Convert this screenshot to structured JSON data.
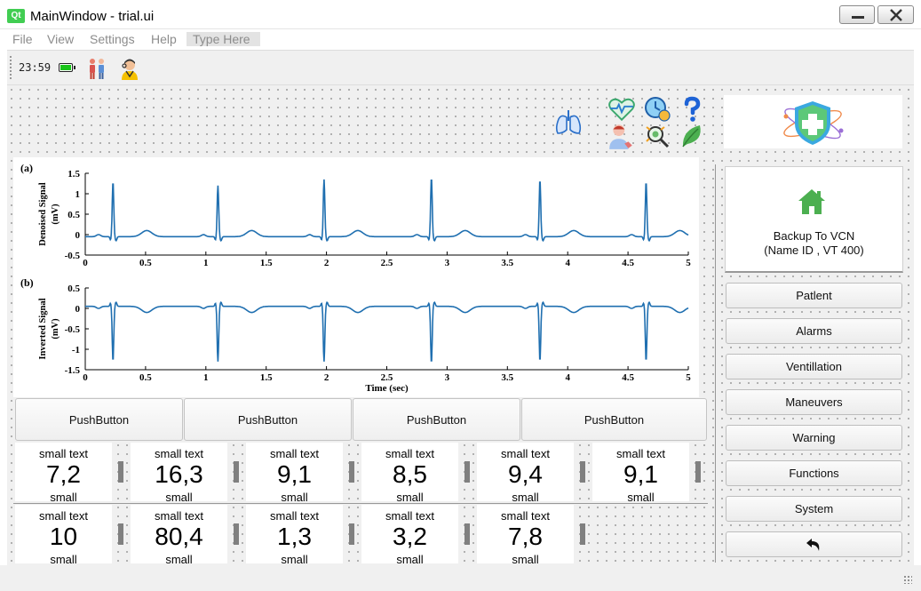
{
  "window": {
    "logo": "Qt",
    "title": "MainWindow - trial.ui",
    "minimize_icon": "minimize-icon",
    "close_icon": "close-icon"
  },
  "menubar": {
    "items": [
      "File",
      "View",
      "Settings",
      "Help"
    ],
    "type_here": "Type Here"
  },
  "toolbar": {
    "time": "23:59",
    "icons": [
      "battery-icon",
      "family-icon",
      "doctor-icon"
    ],
    "battery_color": "#19c419"
  },
  "top_icons": [
    "lungs-icon",
    "heart-monitor-icon",
    "patient-icon",
    "clock-icon",
    "search-virus-icon",
    "help-icon",
    "leaf-icon"
  ],
  "logo_panel": {
    "icon": "shield-medical-icon"
  },
  "chart_data": [
    {
      "type": "line",
      "panel_label": "(a)",
      "ylabel": "Denoised Signal (mV)",
      "xlabel": "",
      "xlim": [
        0,
        5
      ],
      "ylim": [
        -0.5,
        1.5
      ],
      "x_ticks": [
        "0",
        "0.5",
        "1",
        "1.5",
        "2",
        "2.5",
        "3",
        "3.5",
        "4",
        "4.5",
        "5"
      ],
      "y_ticks": [
        "1.5",
        "1",
        "0.5",
        "0",
        "-0.5"
      ],
      "beats_at": [
        0.23,
        1.1,
        1.98,
        2.87,
        3.77,
        4.65
      ],
      "r_peaks": [
        1.3,
        1.2,
        1.35,
        1.4,
        1.35,
        1.3
      ],
      "baseline": -0.05,
      "color": "#1f6fb0"
    },
    {
      "type": "line",
      "panel_label": "(b)",
      "ylabel": "Inverted Signal (mV)",
      "xlabel": "Time (sec)",
      "xlim": [
        0,
        5
      ],
      "ylim": [
        -1.5,
        0.5
      ],
      "x_ticks": [
        "0",
        "0.5",
        "1",
        "1.5",
        "2",
        "2.5",
        "3",
        "3.5",
        "4",
        "4.5",
        "5"
      ],
      "y_ticks": [
        "0.5",
        "0",
        "-0.5",
        "-1",
        "-1.5"
      ],
      "beats_at": [
        0.23,
        1.1,
        1.98,
        2.87,
        3.77,
        4.65
      ],
      "r_peaks": [
        -1.3,
        -1.3,
        -1.3,
        -1.35,
        -1.3,
        -1.3
      ],
      "baseline": 0.05,
      "color": "#1f6fb0"
    }
  ],
  "sidebar": {
    "backup": {
      "icon": "home-icon",
      "icon_color": "#4caf50",
      "line1": "Backup To VCN",
      "line2": "(Name ID , VT 400)"
    },
    "buttons": [
      "Patlent",
      "Alarms",
      "Ventillation",
      "Maneuvers",
      "Warning",
      "Functions",
      "System"
    ],
    "back_icon": "undo-arrow-icon"
  },
  "push_buttons": [
    "PushButton",
    "PushButton",
    "PushButton",
    "PushButton"
  ],
  "tiles": [
    {
      "top": "small text",
      "value": "7,2",
      "bottom": "small"
    },
    {
      "top": "small text",
      "value": "16,3",
      "bottom": "small"
    },
    {
      "top": "small text",
      "value": "9,1",
      "bottom": "small"
    },
    {
      "top": "small text",
      "value": "8,5",
      "bottom": "small"
    },
    {
      "top": "small text",
      "value": "9,4",
      "bottom": "small"
    },
    {
      "top": "small text",
      "value": "9,1",
      "bottom": "small"
    },
    {
      "top": "small text",
      "value": "10",
      "bottom": "small"
    },
    {
      "top": "small text",
      "value": "80,4",
      "bottom": "small"
    },
    {
      "top": "small text",
      "value": "1,3",
      "bottom": "small"
    },
    {
      "top": "small text",
      "value": "3,2",
      "bottom": "small"
    },
    {
      "top": "small text",
      "value": "7,8",
      "bottom": "small"
    }
  ]
}
